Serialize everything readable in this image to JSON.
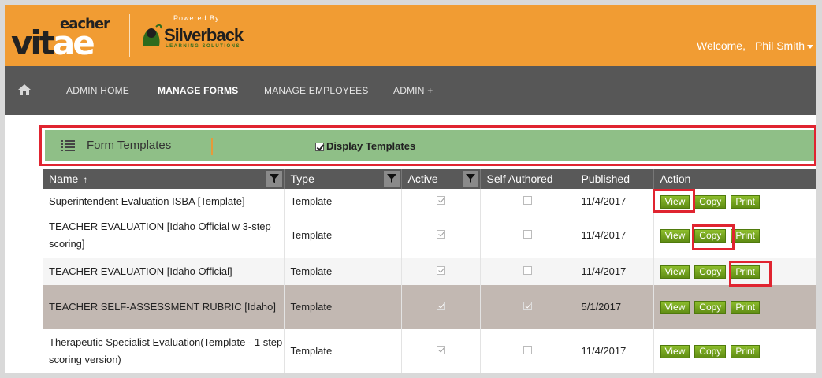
{
  "header": {
    "logo_prefix": "vit",
    "logo_ae": "ae",
    "logo_eacher": "eacher",
    "powered_by": "Powered By",
    "silverback": "Silverback",
    "silverback_sub": "LEARNING SOLUTIONS",
    "welcome": "Welcome,",
    "user": "Phil Smith"
  },
  "nav": {
    "home_icon": "home-icon",
    "items": [
      "ADMIN HOME",
      "MANAGE FORMS",
      "MANAGE EMPLOYEES",
      "ADMIN +"
    ],
    "active": "MANAGE FORMS"
  },
  "toolbar": {
    "title": "Form Templates",
    "display_templates_label": "Display Templates",
    "display_templates_checked": true
  },
  "table": {
    "columns": [
      "Name",
      "Type",
      "Active",
      "Self Authored",
      "Published",
      "Action"
    ],
    "sort_indicator": "↑",
    "rows": [
      {
        "name": "Superintendent Evaluation ISBA [Template]",
        "type": "Template",
        "active": true,
        "self_authored": false,
        "published": "11/4/2017"
      },
      {
        "name": "TEACHER EVALUATION [Idaho Official w 3-step scoring]",
        "type": "Template",
        "active": true,
        "self_authored": false,
        "published": "11/4/2017"
      },
      {
        "name": "TEACHER EVALUATION [Idaho Official]",
        "type": "Template",
        "active": true,
        "self_authored": false,
        "published": "11/4/2017"
      },
      {
        "name": "TEACHER SELF-ASSESSMENT RUBRIC [Idaho]",
        "type": "Template",
        "active": true,
        "self_authored": true,
        "published": "5/1/2017"
      },
      {
        "name": "Therapeutic Specialist Evaluation(Template - 1 step scoring version)",
        "type": "Template",
        "active": true,
        "self_authored": false,
        "published": "11/4/2017"
      }
    ],
    "actions": {
      "view": "View",
      "copy": "Copy",
      "print": "Print"
    }
  },
  "colors": {
    "header_bg": "#f19c33",
    "nav_bg": "#575757",
    "toolbar_bg": "#8fbf87",
    "highlight": "#e02430",
    "button_green": "#6f9e1a"
  }
}
